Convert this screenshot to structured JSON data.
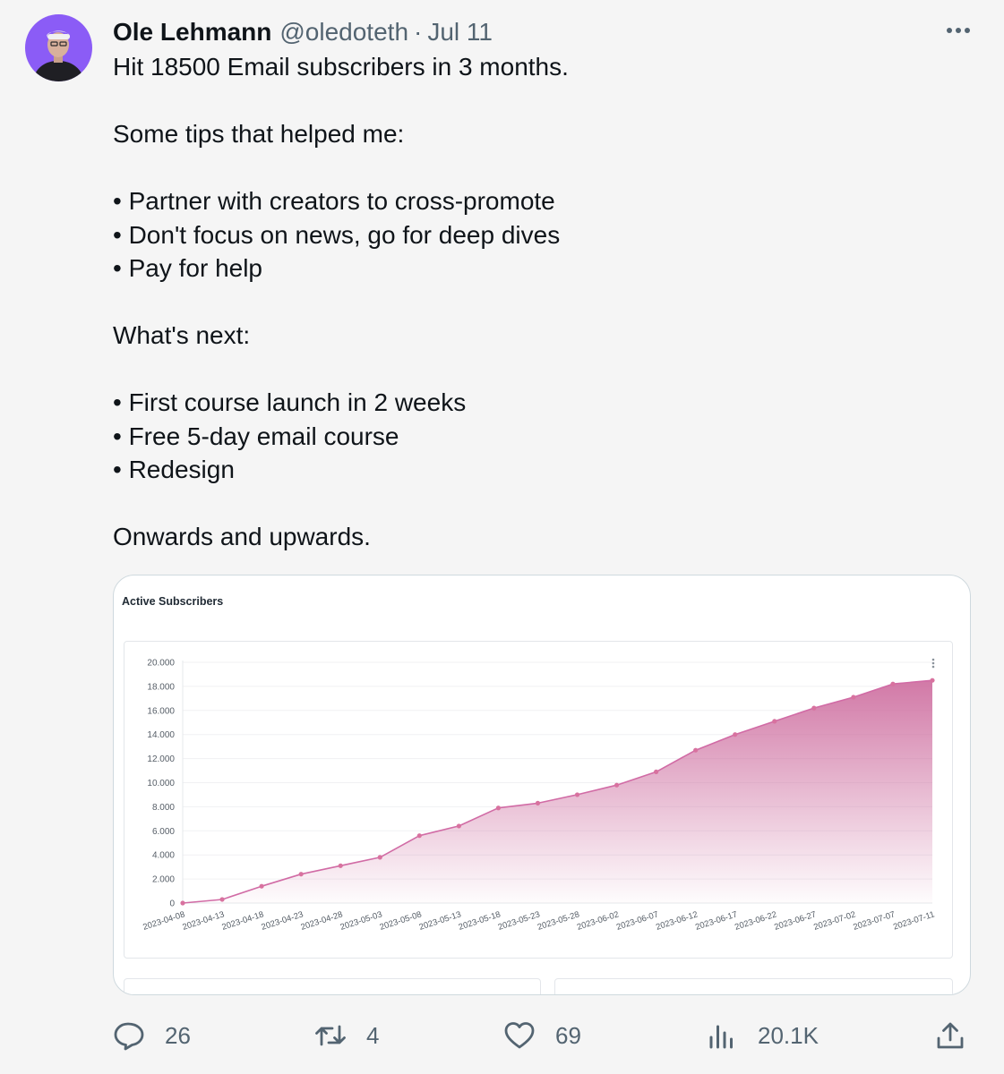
{
  "tweet": {
    "author_name": "Ole Lehmann",
    "handle": "@oledoteth",
    "separator": "·",
    "date": "Jul 11",
    "avatar_icon": "profile-photo",
    "lines": [
      "Hit 18500 Email subscribers in 3 months.",
      "",
      "Some tips that helped me:",
      "",
      "• Partner with creators to cross-promote",
      "• Don't focus on news, go for deep dives",
      "• Pay for help",
      "",
      "What's next:",
      "",
      "• First course launch in 2 weeks",
      "• Free 5-day email course",
      "• Redesign",
      "",
      "Onwards and upwards."
    ]
  },
  "actions": {
    "replies": "26",
    "retweets": "4",
    "likes": "69",
    "views": "20.1K"
  },
  "colors": {
    "line": "#d16ba5",
    "point": "#d8729f",
    "area_top": "#cf72a2",
    "muted": "#536471"
  },
  "chart_data": {
    "type": "area",
    "title": "Active Subscribers",
    "xlabel": "",
    "ylabel": "",
    "ylim": [
      0,
      20000
    ],
    "y_ticks": [
      "0",
      "2.000",
      "4.000",
      "6.000",
      "8.000",
      "10.000",
      "12.000",
      "14.000",
      "16.000",
      "18.000",
      "20.000"
    ],
    "x": [
      "2023-04-08",
      "2023-04-13",
      "2023-04-18",
      "2023-04-23",
      "2023-04-28",
      "2023-05-03",
      "2023-05-08",
      "2023-05-13",
      "2023-05-18",
      "2023-05-23",
      "2023-05-28",
      "2023-06-02",
      "2023-06-07",
      "2023-06-12",
      "2023-06-17",
      "2023-06-22",
      "2023-06-27",
      "2023-07-02",
      "2023-07-07",
      "2023-07-11"
    ],
    "values": [
      0,
      300,
      1400,
      2400,
      3100,
      3800,
      5600,
      6400,
      7900,
      8300,
      9000,
      9800,
      10900,
      12700,
      14000,
      15100,
      16200,
      17100,
      18200,
      18500
    ],
    "grid": true,
    "legend": "none"
  }
}
